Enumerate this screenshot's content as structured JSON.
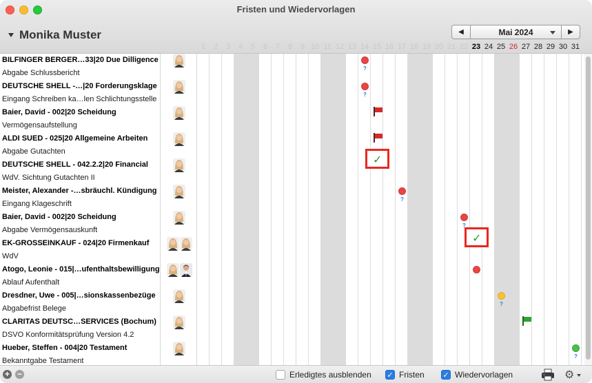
{
  "window": {
    "title": "Fristen und Wiedervorlagen"
  },
  "header": {
    "person_name": "Monika Muster",
    "month_label": "Mai 2024",
    "prev_label": "◀",
    "next_label": "▶"
  },
  "days": [
    "1",
    "2",
    "3",
    "4",
    "5",
    "6",
    "7",
    "8",
    "9",
    "10",
    "11",
    "12",
    "13",
    "14",
    "15",
    "16",
    "17",
    "18",
    "19",
    "20",
    "21",
    "22",
    "23",
    "24",
    "25",
    "26",
    "27",
    "28",
    "29",
    "30",
    "31"
  ],
  "today": "23",
  "rows": [
    {
      "title": "BILFINGER BERGER…33|20 Due Dilligence",
      "subtitle": "Abgabe Schlussbericht"
    },
    {
      "title": "DEUTSCHE SHELL -…|20 Forderungsklage",
      "subtitle": "Eingang Schreiben ka…len Schlichtungsstelle"
    },
    {
      "title": "Baier, David - 002|20 Scheidung",
      "subtitle": "Vermögensaufstellung"
    },
    {
      "title": "ALDI SUED - 025|20 Allgemeine Arbeiten",
      "subtitle": "Abgabe Gutachten"
    },
    {
      "title": "DEUTSCHE SHELL - 042.2.2|20 Financial",
      "subtitle": "WdV. Sichtung Gutachten II"
    },
    {
      "title": "Meister, Alexander -…sbräuchl. Kündigung",
      "subtitle": "Eingang Klageschrift"
    },
    {
      "title": "Baier, David - 002|20 Scheidung",
      "subtitle": "Abgabe Vermögensauskunft"
    },
    {
      "title": "EK-GROSSEINKAUF - 024|20 Firmenkauf",
      "subtitle": "WdV"
    },
    {
      "title": "Atogo, Leonie - 015|…ufenthaltsbewilligung",
      "subtitle": "Ablauf Aufenthalt"
    },
    {
      "title": "Dresdner, Uwe - 005|…sionskassenbezüge",
      "subtitle": "Abgabefrist Belege"
    },
    {
      "title": "CLARITAS DEUTSC…SERVICES (Bochum)",
      "subtitle": "DSVO Konformitätsprüfung Version 4.2"
    },
    {
      "title": "Hueber, Steffen - 004|20 Testament",
      "subtitle": "Bekanntgabe Testament"
    }
  ],
  "markers": [
    {
      "row": 0,
      "day": 14,
      "kind": "dot",
      "color": "red",
      "note": "?"
    },
    {
      "row": 1,
      "day": 14,
      "kind": "dot",
      "color": "red",
      "note": "?"
    },
    {
      "row": 2,
      "day": 15,
      "kind": "flag",
      "color": "red"
    },
    {
      "row": 3,
      "day": 15,
      "kind": "flag",
      "color": "red"
    },
    {
      "row": 4,
      "day": 15,
      "kind": "check",
      "highlight": true
    },
    {
      "row": 5,
      "day": 17,
      "kind": "dot",
      "color": "red",
      "note": "?"
    },
    {
      "row": 6,
      "day": 22,
      "kind": "dot",
      "color": "red",
      "note": "?"
    },
    {
      "row": 7,
      "day": 23,
      "kind": "check",
      "highlight": true
    },
    {
      "row": 8,
      "day": 23,
      "kind": "dot",
      "color": "red"
    },
    {
      "row": 9,
      "day": 25,
      "kind": "dot",
      "color": "yellow",
      "note": "?"
    },
    {
      "row": 10,
      "day": 27,
      "kind": "flag",
      "color": "green"
    },
    {
      "row": 11,
      "day": 31,
      "kind": "dot",
      "color": "green",
      "note": "?"
    }
  ],
  "footer": {
    "hide_done_label": "Erledigtes ausblenden",
    "fristen_label": "Fristen",
    "wiedervorlagen_label": "Wiedervorlagen",
    "hide_done_checked": false,
    "fristen_checked": true,
    "wiedervorlagen_checked": true
  },
  "colors": {
    "accent": "#2a7de1",
    "highlight": "#e8281e",
    "weekend": "#dcdcdc",
    "sunday_text": "#d0272a"
  }
}
